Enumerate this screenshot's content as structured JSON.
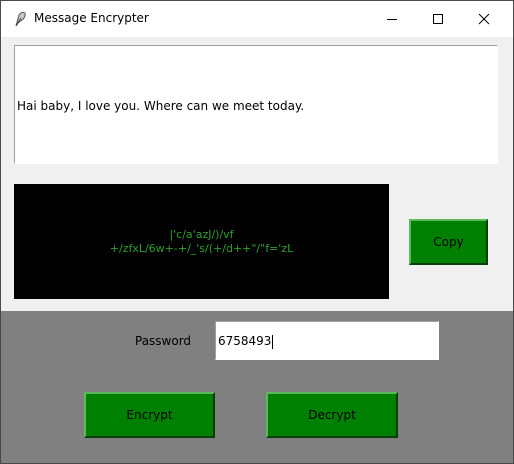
{
  "window": {
    "title": "Message Encrypter",
    "icon": "feather-pen-icon",
    "controls": [
      "minimize-icon",
      "maximize-icon",
      "close-icon"
    ]
  },
  "message_input": {
    "value": "Hai baby, I love you. Where can we meet today."
  },
  "encrypted_output": {
    "line1": "|'c/a'azJ/)/vf",
    "line2": "+/zfxL/6w+-+/_'s/(+/d++\"/\"f='zL",
    "text_color": "#2ea02e",
    "background": "#000000"
  },
  "buttons": {
    "copy": "Copy",
    "encrypt": "Encrypt",
    "decrypt": "Decrypt",
    "color": "#008000"
  },
  "password": {
    "label": "Password",
    "value": "6758493"
  },
  "colors": {
    "panel": "#808080",
    "window_bg": "#f0f0f0"
  }
}
